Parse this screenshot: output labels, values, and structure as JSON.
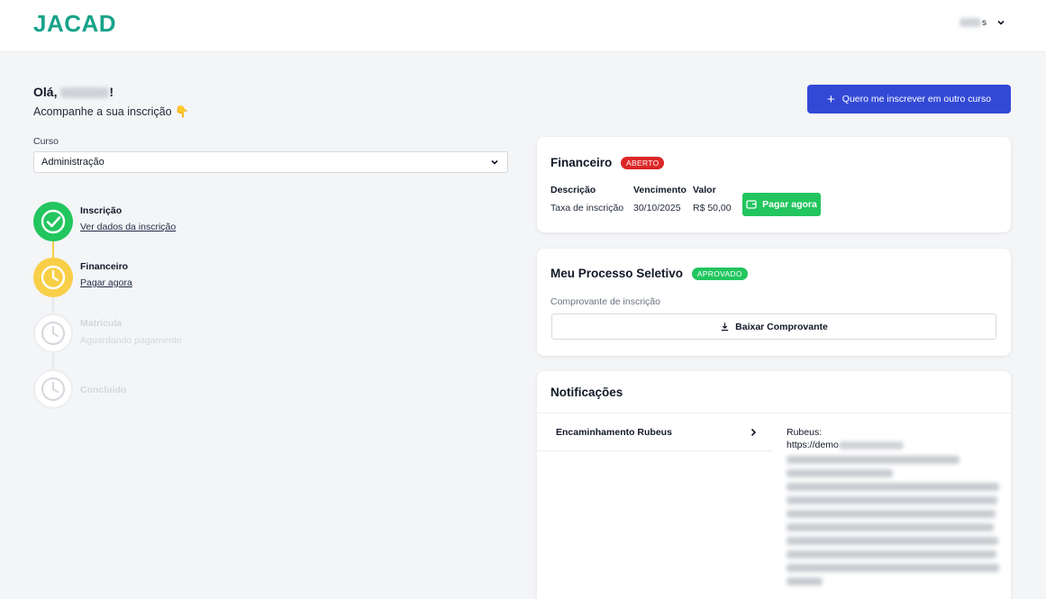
{
  "header": {
    "logo": "JACAD",
    "user_name_suffix": "s"
  },
  "greeting": {
    "prefix": "Olá,",
    "suffix": "!",
    "subtitle": "Acompanhe a sua inscrição 👇"
  },
  "actions": {
    "enroll_other_label": "Quero me inscrever em outro curso"
  },
  "course": {
    "label": "Curso",
    "selected": "Administração"
  },
  "steps": [
    {
      "title": "Inscrição",
      "link": "Ver dados da inscrição",
      "status": "done"
    },
    {
      "title": "Financeiro",
      "link": "Pagar agora",
      "status": "current"
    },
    {
      "title": "Matrícula",
      "subtitle": "Aguardando pagamento",
      "status": "pending"
    },
    {
      "title": "Concluído",
      "status": "pending"
    }
  ],
  "financeiro": {
    "title": "Financeiro",
    "badge": "ABERTO",
    "headers": [
      "Descrição",
      "Vencimento",
      "Valor"
    ],
    "row": [
      "Taxa de inscrição",
      "30/10/2025",
      "R$ 50,00"
    ],
    "pay_label": "Pagar agora"
  },
  "processo": {
    "title": "Meu Processo Seletivo",
    "badge": "APROVADO",
    "proof_label": "Comprovante de inscrição",
    "download_label": "Baixar Comprovante"
  },
  "notificacoes": {
    "title": "Notificações",
    "items": [
      {
        "label": "Encaminhamento Rubeus"
      }
    ],
    "body_title": "Rubeus:",
    "body_link_prefix": "https://demo"
  },
  "colors": {
    "brand": "#18a38a",
    "primary_button": "#3349d6",
    "success": "#22c55e",
    "warning": "#f8cf47",
    "danger": "#dc2626"
  }
}
